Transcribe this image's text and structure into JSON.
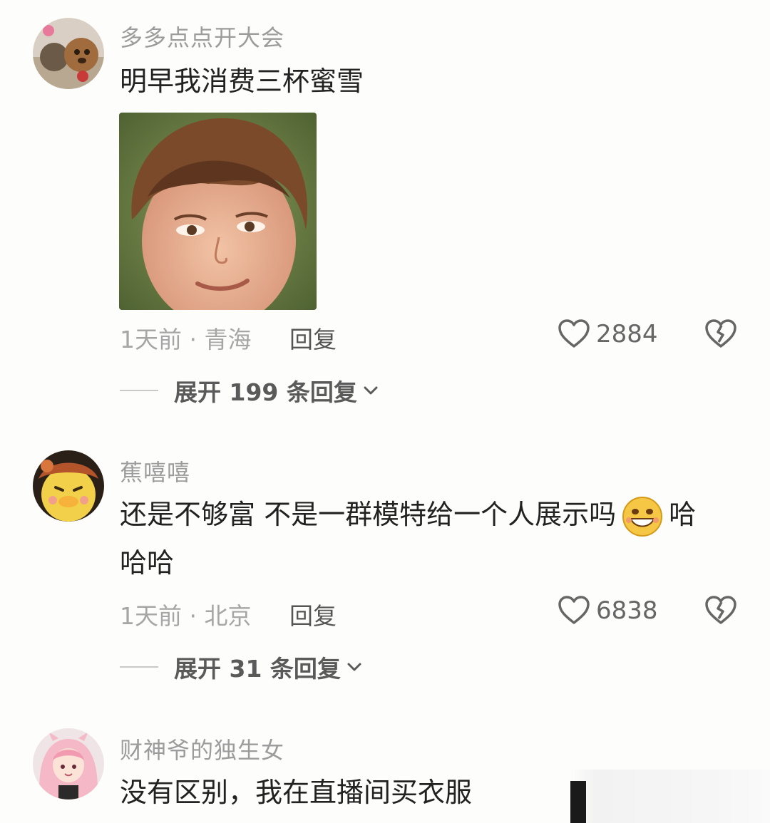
{
  "comments": [
    {
      "username": "多多点点开大会",
      "text_lines": [
        "明早我消费三杯蜜雪"
      ],
      "meta": "1天前 · 青海",
      "reply_label": "回复",
      "likes": "2884",
      "expand_label": "展开 199 条回复"
    },
    {
      "username": "蕉嘻嘻",
      "text_lines": [
        "还是不够富 不是一群模特给一个人展示吗",
        "哈",
        "哈哈"
      ],
      "meta": "1天前 · 北京",
      "reply_label": "回复",
      "likes": "6838",
      "expand_label": "展开 31 条回复"
    },
    {
      "username": "财神爷的独生女",
      "text_lines": [
        "没有区别，我在直播间买衣服"
      ]
    }
  ],
  "icons": {
    "like": "heart-outline-icon",
    "dislike": "broken-heart-icon",
    "expand": "chevron-down-icon",
    "emoji": "grin-emoji-icon"
  },
  "colors": {
    "username": "#9c9c9c",
    "text": "#222222",
    "meta": "#a6a6a6",
    "background": "#fdfdfb"
  }
}
